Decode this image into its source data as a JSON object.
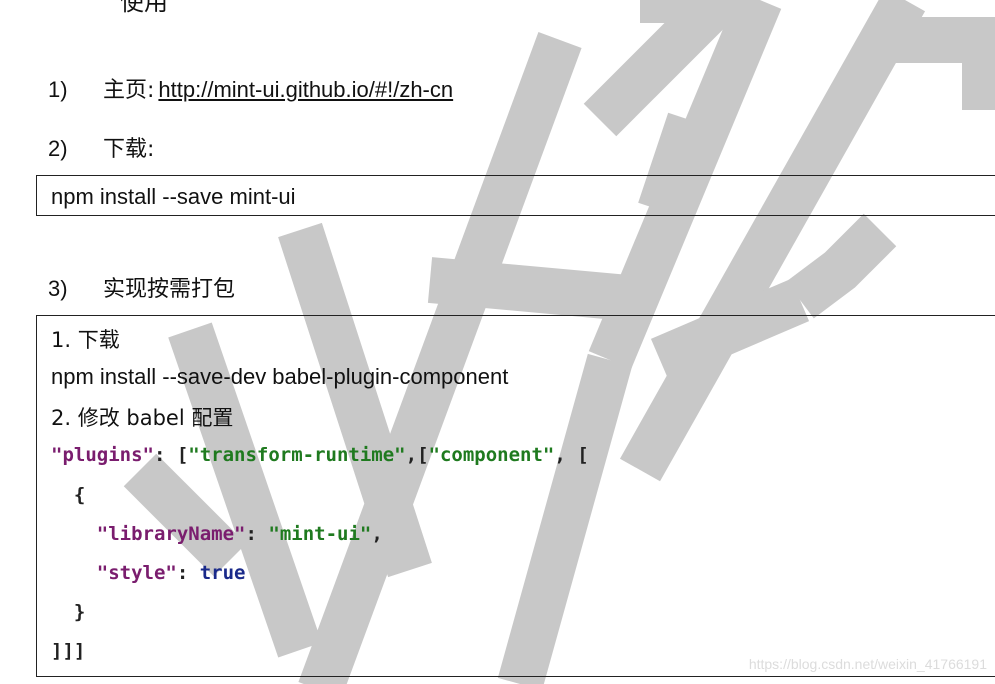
{
  "header": {
    "cut_text": "使用"
  },
  "steps": [
    {
      "num": "1)",
      "label": "主页:",
      "link": "http://mint-ui.github.io/#!/zh-cn"
    },
    {
      "num": "2)",
      "label": "下载:"
    },
    {
      "num": "3)",
      "label": "实现按需打包"
    }
  ],
  "download_box": {
    "command": "npm install --save mint-ui"
  },
  "config_box": {
    "line1": "1. 下载",
    "line2": "npm install --save-dev babel-plugin-component",
    "line3": "2. 修改 babel 配置",
    "code": {
      "l1_key": "\"plugins\"",
      "l1_colon": ": [",
      "l1_str1": "\"transform-runtime\"",
      "l1_mid": ",[",
      "l1_str2": "\"component\"",
      "l1_end": ", [",
      "l2": "  {",
      "l3_key": "\"libraryName\"",
      "l3_colon": ": ",
      "l3_val": "\"mint-ui\"",
      "l3_end": ",",
      "l4_key": "\"style\"",
      "l4_colon": ": ",
      "l4_val": "true",
      "l5": "  }",
      "l6": "]]]"
    }
  },
  "watermark": {
    "source_text": "https://blog.csdn.net/weixin_41766191",
    "stroke_color": "#c8c8c8"
  }
}
